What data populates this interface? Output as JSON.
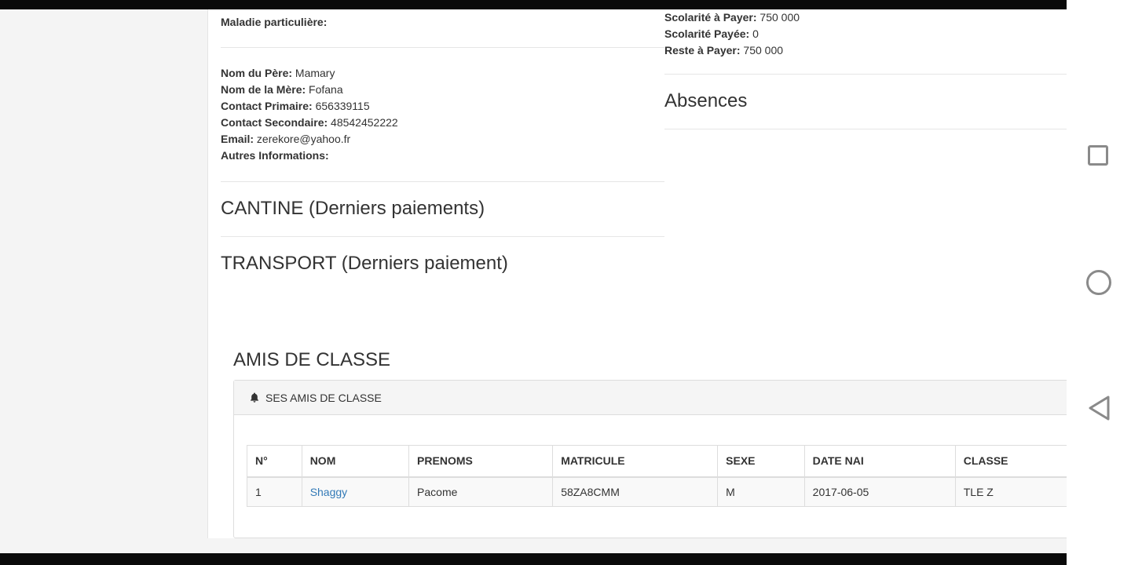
{
  "left_info_top": {
    "maladie_label": "Maladie particulière:"
  },
  "parents": {
    "pere_label": "Nom du Père:",
    "pere_value": "Mamary",
    "mere_label": "Nom de la Mère:",
    "mere_value": "Fofana",
    "contact1_label": "Contact Primaire:",
    "contact1_value": "656339115",
    "contact2_label": "Contact Secondaire:",
    "contact2_value": "48542452222",
    "email_label": "Email:",
    "email_value": "zerekore@yahoo.fr",
    "autres_label": "Autres Informations:"
  },
  "scolarite": {
    "a_payer_label": "Scolarité à Payer:",
    "a_payer_value": "750 000",
    "payee_label": "Scolarité Payée:",
    "payee_value": "0",
    "reste_label": "Reste à Payer:",
    "reste_value": "750 000"
  },
  "headings": {
    "absences": "Absences",
    "cantine": "CANTINE (Derniers paiements)",
    "transport": "TRANSPORT (Derniers paiement)",
    "amis": "AMIS DE CLASSE"
  },
  "panel": {
    "title": "SES AMIS DE CLASSE",
    "icon": "bell-icon"
  },
  "table": {
    "headers": [
      "N°",
      "NOM",
      "PRENOMS",
      "MATRICULE",
      "SEXE",
      "DATE NAI",
      "CLASSE"
    ],
    "rows": [
      [
        "1",
        "Shaggy",
        "Pacome",
        "58ZA8CMM",
        "M",
        "2017-06-05",
        "TLE Z"
      ]
    ]
  },
  "colors": {
    "link": "#337ab7",
    "text": "#333333"
  }
}
